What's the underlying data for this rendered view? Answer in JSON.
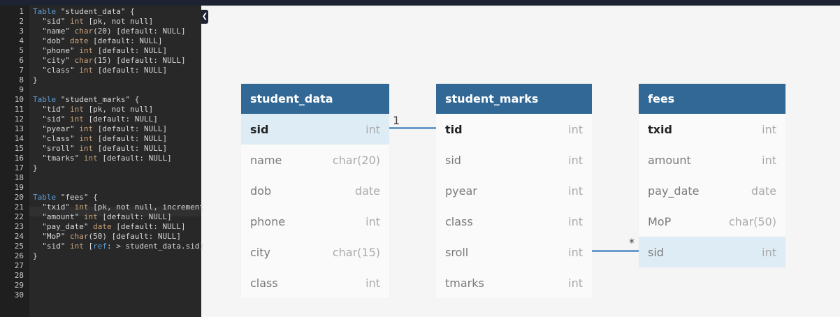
{
  "editor": {
    "lines": [
      [
        [
          "kw",
          "Table"
        ],
        [
          "t",
          " \"student_data\" {"
        ]
      ],
      [
        [
          "t",
          "  \"sid\" "
        ],
        [
          "ty",
          "int"
        ],
        [
          "t",
          " [pk, not null]"
        ]
      ],
      [
        [
          "t",
          "  \"name\" "
        ],
        [
          "ty",
          "char"
        ],
        [
          "t",
          "(20) [default: NULL]"
        ]
      ],
      [
        [
          "t",
          "  \"dob\" "
        ],
        [
          "ty",
          "date"
        ],
        [
          "t",
          " [default: NULL]"
        ]
      ],
      [
        [
          "t",
          "  \"phone\" "
        ],
        [
          "ty",
          "int"
        ],
        [
          "t",
          " [default: NULL]"
        ]
      ],
      [
        [
          "t",
          "  \"city\" "
        ],
        [
          "ty",
          "char"
        ],
        [
          "t",
          "(15) [default: NULL]"
        ]
      ],
      [
        [
          "t",
          "  \"class\" "
        ],
        [
          "ty",
          "int"
        ],
        [
          "t",
          " [default: NULL]"
        ]
      ],
      [
        [
          "t",
          "}"
        ]
      ],
      [],
      [
        [
          "kw",
          "Table"
        ],
        [
          "t",
          " \"student_marks\" {"
        ]
      ],
      [
        [
          "t",
          "  \"tid\" "
        ],
        [
          "ty",
          "int"
        ],
        [
          "t",
          " [pk, not null]"
        ]
      ],
      [
        [
          "t",
          "  \"sid\" "
        ],
        [
          "ty",
          "int"
        ],
        [
          "t",
          " [default: NULL]"
        ]
      ],
      [
        [
          "t",
          "  \"pyear\" "
        ],
        [
          "ty",
          "int"
        ],
        [
          "t",
          " [default: NULL]"
        ]
      ],
      [
        [
          "t",
          "  \"class\" "
        ],
        [
          "ty",
          "int"
        ],
        [
          "t",
          " [default: NULL]"
        ]
      ],
      [
        [
          "t",
          "  \"sroll\" "
        ],
        [
          "ty",
          "int"
        ],
        [
          "t",
          " [default: NULL]"
        ]
      ],
      [
        [
          "t",
          "  \"tmarks\" "
        ],
        [
          "ty",
          "int"
        ],
        [
          "t",
          " [default: NULL]"
        ]
      ],
      [
        [
          "t",
          "}"
        ]
      ],
      [],
      [],
      [
        [
          "kw",
          "Table"
        ],
        [
          "t",
          " \"fees\" {"
        ]
      ],
      [
        [
          "t",
          "  \"txid\" "
        ],
        [
          "ty",
          "int"
        ],
        [
          "t",
          " [pk, not null, increment"
        ]
      ],
      [
        [
          "t",
          "  \"amount\" "
        ],
        [
          "ty",
          "int"
        ],
        [
          "t",
          " [default: NULL]"
        ]
      ],
      [
        [
          "t",
          "  \"pay_date\" "
        ],
        [
          "ty",
          "date"
        ],
        [
          "t",
          " [default: NULL]"
        ]
      ],
      [
        [
          "t",
          "  \"MoP\" "
        ],
        [
          "ty",
          "char"
        ],
        [
          "t",
          "(50) [default: NULL]"
        ]
      ],
      [
        [
          "t",
          "  \"sid\" "
        ],
        [
          "ty",
          "int"
        ],
        [
          "t",
          " ["
        ],
        [
          "kw",
          "ref"
        ],
        [
          "t",
          ": > student_data.sid]"
        ]
      ],
      [
        [
          "t",
          "}"
        ]
      ],
      [],
      [],
      [],
      []
    ]
  },
  "collapse_icon": "chevron-left-icon",
  "tables": [
    {
      "name": "student_data",
      "fields": [
        [
          "sid",
          "int"
        ],
        [
          "name",
          "char(20)"
        ],
        [
          "dob",
          "date"
        ],
        [
          "phone",
          "int"
        ],
        [
          "city",
          "char(15)"
        ],
        [
          "class",
          "int"
        ]
      ],
      "pk": 0,
      "highlight": 0
    },
    {
      "name": "student_marks",
      "fields": [
        [
          "tid",
          "int"
        ],
        [
          "sid",
          "int"
        ],
        [
          "pyear",
          "int"
        ],
        [
          "class",
          "int"
        ],
        [
          "sroll",
          "int"
        ],
        [
          "tmarks",
          "int"
        ]
      ],
      "pk": 0,
      "highlight": -1
    },
    {
      "name": "fees",
      "fields": [
        [
          "txid",
          "int"
        ],
        [
          "amount",
          "int"
        ],
        [
          "pay_date",
          "date"
        ],
        [
          "MoP",
          "char(50)"
        ],
        [
          "sid",
          "int"
        ]
      ],
      "pk": 0,
      "highlight": 4
    }
  ],
  "relations": [
    {
      "one": "1",
      "many": "*"
    }
  ],
  "colors": {
    "header": "#316896",
    "highlight": "#deedf5",
    "line": "#6a9ccc"
  }
}
